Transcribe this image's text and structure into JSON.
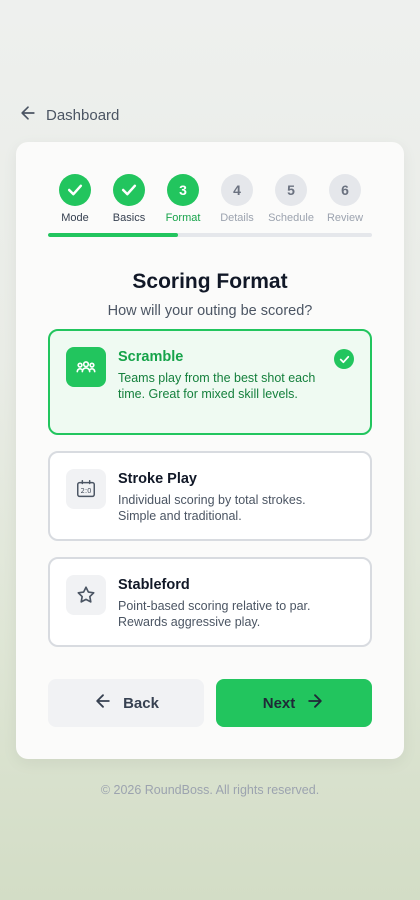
{
  "nav": {
    "back_label": "Dashboard"
  },
  "wizard": {
    "progress_fraction": 0.4,
    "steps": [
      {
        "number": "1",
        "label": "Mode",
        "state": "done"
      },
      {
        "number": "2",
        "label": "Basics",
        "state": "done"
      },
      {
        "number": "3",
        "label": "Format",
        "state": "active"
      },
      {
        "number": "4",
        "label": "Details",
        "state": "pending"
      },
      {
        "number": "5",
        "label": "Schedule",
        "state": "pending"
      },
      {
        "number": "6",
        "label": "Review",
        "state": "pending"
      }
    ]
  },
  "content": {
    "title": "Scoring Format",
    "subtitle": "How will your outing be scored?",
    "options": [
      {
        "title": "Scramble",
        "description": "Teams play from the best shot each time. Great for mixed skill levels.",
        "icon": "group-icon",
        "selected": true
      },
      {
        "title": "Stroke Play",
        "description": "Individual scoring by total strokes. Simple and traditional.",
        "icon": "scoreboard-icon",
        "selected": false
      },
      {
        "title": "Stableford",
        "description": "Point-based scoring relative to par. Rewards aggressive play.",
        "icon": "star-icon",
        "selected": false
      }
    ]
  },
  "actions": {
    "back_label": "Back",
    "next_label": "Next"
  },
  "footer": {
    "text": "© 2026 RoundBoss. All rights reserved."
  },
  "colors": {
    "accent": "#22c55e",
    "accent_text": "#16a34a"
  }
}
